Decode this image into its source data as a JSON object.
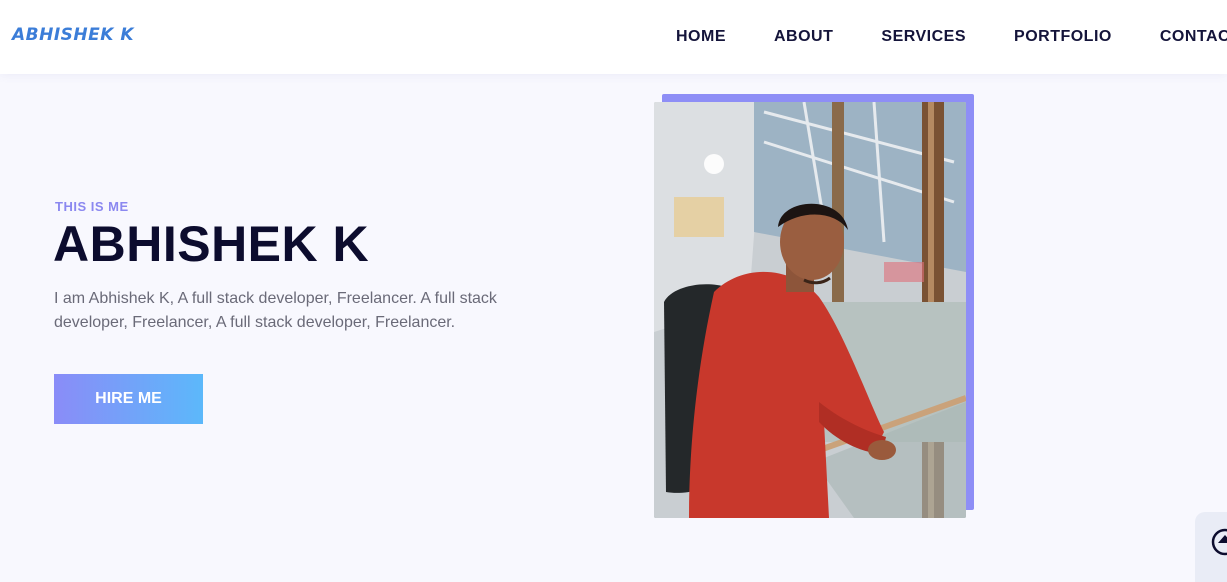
{
  "header": {
    "logo": "ABHISHEK K",
    "nav": [
      "HOME",
      "ABOUT",
      "SERVICES",
      "PORTFOLIO",
      "CONTACT"
    ]
  },
  "hero": {
    "eyebrow": "THIS IS ME",
    "title": "ABHISHEK K",
    "description": "I am Abhishek K, A full stack developer, Freelancer. A full stack developer, Freelancer, A full stack developer, Freelancer.",
    "button_label": "HIRE ME"
  },
  "colors": {
    "accent": "#8e8ef6",
    "title": "#0c0c2e",
    "button_gradient_start": "#8a8cf8",
    "button_gradient_end": "#5cb8fa"
  },
  "icons": {
    "scroll_top": "arrow-up-circle-icon"
  }
}
